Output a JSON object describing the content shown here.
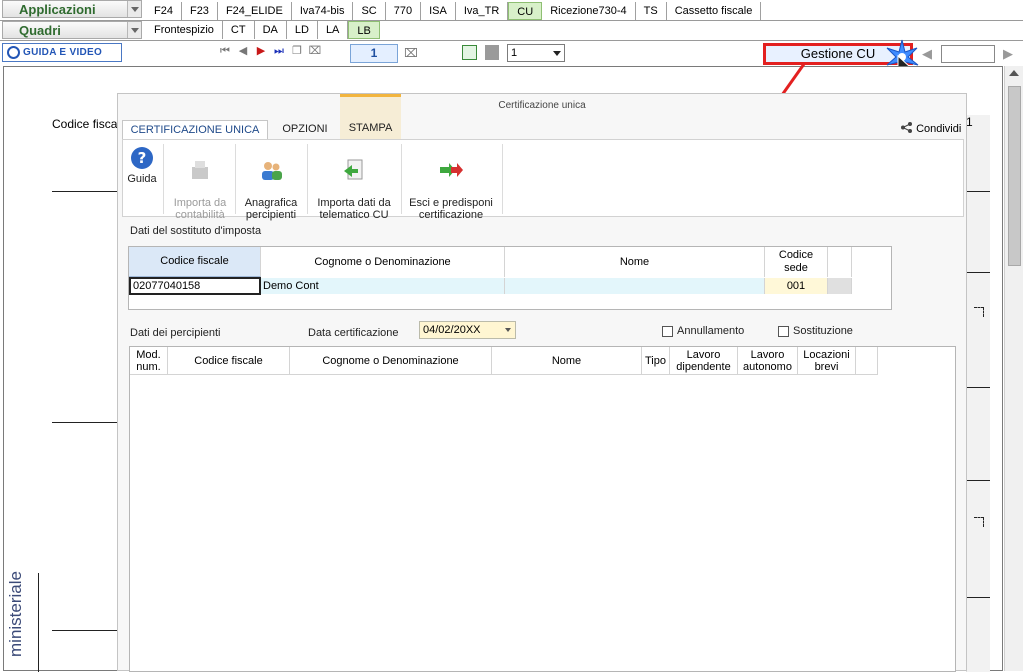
{
  "menu": {
    "applicazioni": "Applicazioni",
    "quadri": "Quadri"
  },
  "apps_tabs": [
    "F24",
    "F23",
    "F24_ELIDE",
    "Iva74-bis",
    "SC",
    "770",
    "ISA",
    "Iva_TR",
    "CU",
    "Ricezione730-4",
    "TS",
    "Cassetto fiscale"
  ],
  "apps_active": "CU",
  "quadri_tabs": [
    "Frontespizio",
    "CT",
    "DA",
    "LD",
    "LA",
    "LB"
  ],
  "quadri_active": "LB",
  "toolbar": {
    "guida_video": "GUIDA E VIDEO",
    "page_number": "1",
    "select_value": "1",
    "gestione_cu": "Gestione CU"
  },
  "background_doc": {
    "codice_fiscale_label": "Codice fiscal",
    "side_label": "ministeriale",
    "page_num_right": "1"
  },
  "modal": {
    "title": "Certificazione unica",
    "tabs": [
      "CERTIFICAZIONE UNICA",
      "OPZIONI",
      "STAMPA"
    ],
    "share": "Condividi",
    "ribbon": {
      "guida": "Guida",
      "importa_contabilita": "Importa da\ncontabilità",
      "anagrafica": "Anagrafica\npercipienti",
      "importa_telematico": "Importa dati da\ntelematico CU",
      "esci": "Esci e predisponi\ncertificazione"
    },
    "sostituto": {
      "section_title": "Dati del sostituto d'imposta",
      "headers": [
        "Codice fiscale",
        "Cognome o Denominazione",
        "Nome",
        "Codice\nsede"
      ],
      "row": {
        "codice_fiscale": "02077040158",
        "denominazione": "Demo Cont",
        "nome": "",
        "codice_sede": "001"
      }
    },
    "percipienti": {
      "section_title": "Dati dei percipienti",
      "data_cert_label": "Data certificazione",
      "data_cert_value": "04/02/20XX",
      "annullamento": "Annullamento",
      "sostituzione": "Sostituzione",
      "headers": [
        "Mod.\nnum.",
        "Codice fiscale",
        "Cognome o Denominazione",
        "Nome",
        "Tipo",
        "Lavoro\ndipendente",
        "Lavoro\nautonomo",
        "Locazioni\nbrevi"
      ]
    }
  },
  "colors": {
    "active_tab_green": "#d8f0c9",
    "highlight_red": "#e32020",
    "link_blue": "#2356b6"
  }
}
